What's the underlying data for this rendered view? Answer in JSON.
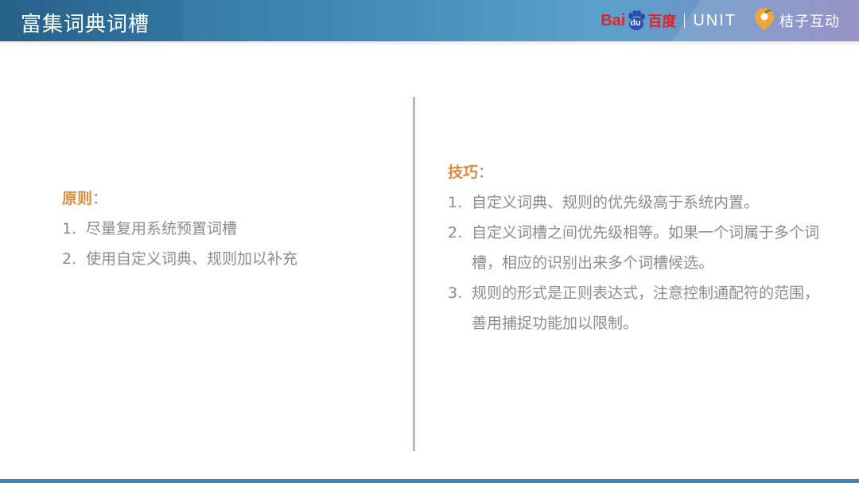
{
  "header": {
    "title": "富集词典词槽",
    "logos": {
      "baidu_left": "Bai",
      "baidu_du": "du",
      "baidu_cn": "百度",
      "unit": "UNIT",
      "partner": "桔子互动"
    }
  },
  "left": {
    "heading": "原则",
    "colon": "：",
    "items": [
      {
        "num": "1.",
        "text": "尽量复用系统预置词槽"
      },
      {
        "num": "2.",
        "text": "使用自定义词典、规则加以补充"
      }
    ]
  },
  "right": {
    "heading": "技巧",
    "colon": "：",
    "items": [
      {
        "num": "1.",
        "text": "自定义词典、规则的优先级高于系统内置。"
      },
      {
        "num": "2.",
        "text": "自定义词槽之间优先级相等。如果一个词属于多个词槽，相应的识别出来多个词槽候选。"
      },
      {
        "num": "3.",
        "text": "规则的形式是正则表达式，注意控制通配符的范围，善用捕捉功能加以限制。"
      }
    ]
  },
  "colors": {
    "header_blue": "#3c86b4",
    "accent_orange": "#e08a3c",
    "body_text": "#8c8c8c",
    "baidu_red": "#e0242b"
  },
  "icons": [
    "baidu-paw-icon",
    "orange-pin-icon"
  ]
}
